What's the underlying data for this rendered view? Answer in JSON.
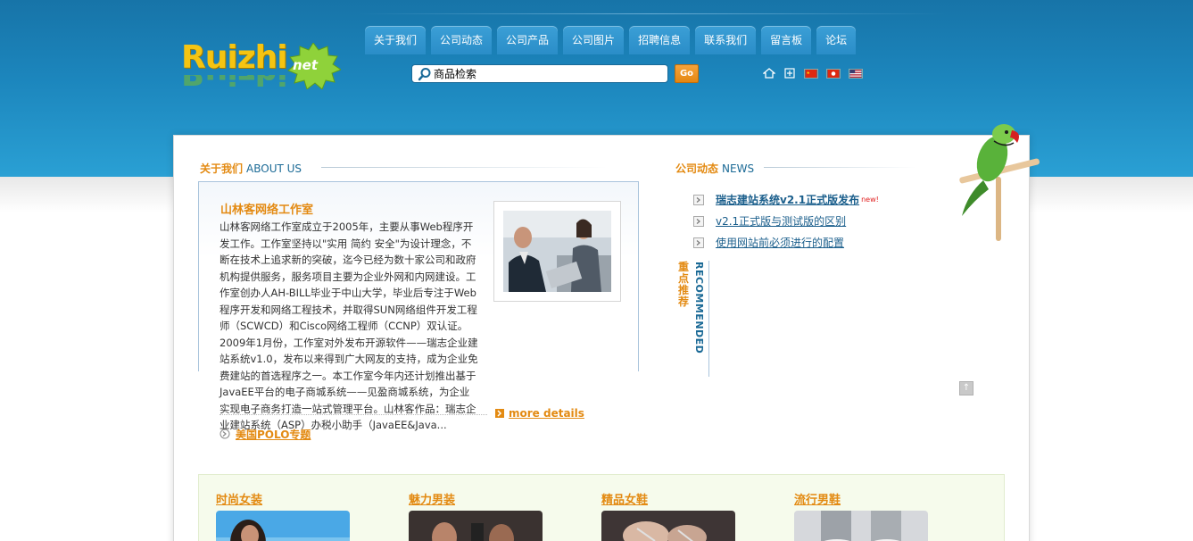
{
  "header": {
    "logo": {
      "text": "Ruizhi",
      "badge": "net"
    },
    "nav": [
      {
        "label": "关于我们"
      },
      {
        "label": "公司动态"
      },
      {
        "label": "公司产品"
      },
      {
        "label": "公司图片"
      },
      {
        "label": "招聘信息"
      },
      {
        "label": "联系我们"
      },
      {
        "label": "留言板"
      },
      {
        "label": "论坛"
      }
    ],
    "search": {
      "value": "商品检索",
      "button": "Go"
    },
    "toolbar_icons": [
      "home-icon",
      "add-favorite-icon",
      "flag-cn-icon",
      "flag-hk-icon",
      "flag-us-icon"
    ]
  },
  "about": {
    "title_cn": "关于我们",
    "title_en": "ABOUT US",
    "heading": "山林客网络工作室",
    "text": "山林客网络工作室成立于2005年，主要从事Web程序开发工作。工作室坚持以\"实用 简约 安全\"为设计理念，不断在技术上追求新的突破，迄今已经为数十家公司和政府机构提供服务，服务项目主要为企业外网和内网建设。工作室创办人AH-BILL毕业于中山大学，毕业后专注于Web程序开发和网络工程技术，并取得SUN网络组件开发工程师（SCWCD）和Cisco网络工程师（CCNP）双认证。2009年1月份，工作室对外发布开源软件——瑞志企业建站系统v1.0，发布以来得到广大网友的支持，成为企业免费建站的首选程序之一。本工作室今年内还计划推出基于JavaEE平台的电子商城系统——见盈商城系统，为企业实现电子商务打造一站式管理平台。山林客作品：瑞志企业建站系统（ASP）办税小助手（JavaEE&Java...",
    "more": "more details",
    "special_link": "美国POLO专题"
  },
  "news": {
    "title_cn": "公司动态",
    "title_en": "NEWS",
    "items": [
      {
        "label": "瑞志建站系统v2.1正式版发布",
        "badge": "new!"
      },
      {
        "label": "v2.1正式版与测试版的区别"
      },
      {
        "label": "使用网站前必须进行的配置"
      }
    ],
    "recommend_cn": "重点推荐",
    "recommend_en": "RECOMMENDED"
  },
  "products": [
    {
      "label": "时尚女装"
    },
    {
      "label": "魅力男装"
    },
    {
      "label": "精品女鞋"
    },
    {
      "label": "流行男鞋"
    }
  ],
  "colors": {
    "header_blue": "#1c86bd",
    "nav_tab": "#2a8dc8",
    "accent_orange": "#e38a12",
    "link_blue": "#1b5f8c",
    "products_bg": "#f6fbec"
  }
}
